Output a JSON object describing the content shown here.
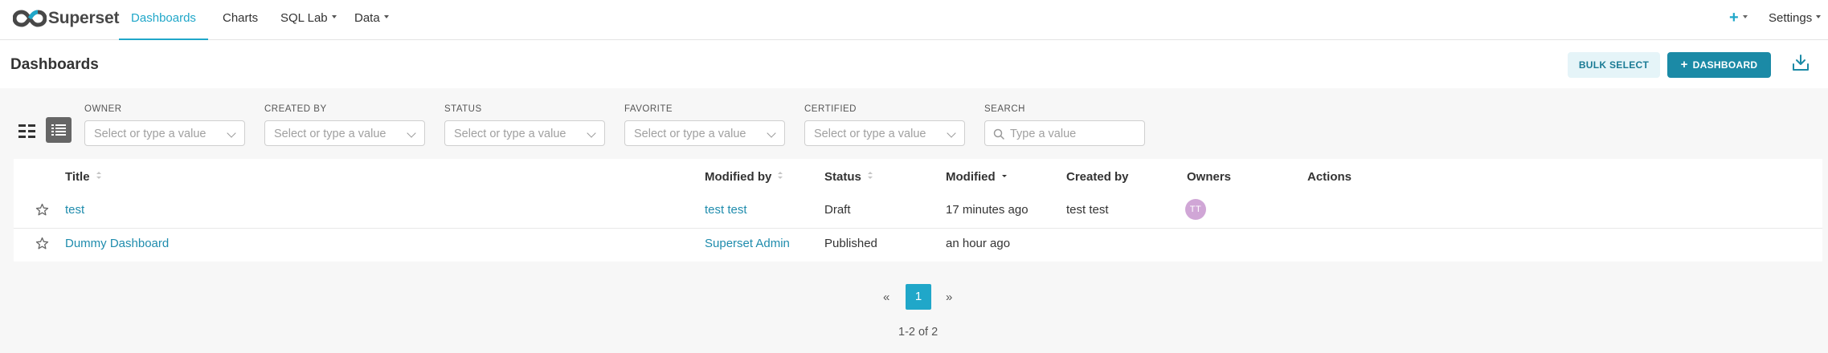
{
  "brand": {
    "name": "Superset"
  },
  "nav": {
    "items": [
      {
        "label": "Dashboards",
        "active": true
      },
      {
        "label": "Charts"
      },
      {
        "label": "SQL Lab",
        "dropdown": true
      },
      {
        "label": "Data",
        "dropdown": true
      }
    ],
    "right": {
      "plus_label": "+",
      "settings_label": "Settings"
    }
  },
  "header": {
    "title": "Dashboards",
    "bulk_select_label": "BULK SELECT",
    "new_dashboard_label": "DASHBOARD",
    "new_dashboard_plus": "+"
  },
  "filters": [
    {
      "label": "OWNER",
      "placeholder": "Select or type a value"
    },
    {
      "label": "CREATED BY",
      "placeholder": "Select or type a value"
    },
    {
      "label": "STATUS",
      "placeholder": "Select or type a value"
    },
    {
      "label": "FAVORITE",
      "placeholder": "Select or type a value"
    },
    {
      "label": "CERTIFIED",
      "placeholder": "Select or type a value"
    }
  ],
  "search": {
    "label": "SEARCH",
    "placeholder": "Type a value"
  },
  "table": {
    "columns": [
      "Title",
      "Modified by",
      "Status",
      "Modified",
      "Created by",
      "Owners",
      "Actions"
    ],
    "rows": [
      {
        "title": "test",
        "modified_by": "test test",
        "status": "Draft",
        "modified": "17 minutes ago",
        "created_by": "test test",
        "owner_initials": "TT"
      },
      {
        "title": "Dummy Dashboard",
        "modified_by": "Superset Admin",
        "status": "Published",
        "modified": "an hour ago",
        "created_by": "",
        "owner_initials": ""
      }
    ]
  },
  "pagination": {
    "prev": "«",
    "current": "1",
    "next": "»",
    "summary": "1-2 of 2"
  },
  "colors": {
    "accent": "#20a7c9",
    "primary_button": "#1b8aa6",
    "link": "#1f8cad",
    "avatar": "#d0a6d6"
  }
}
